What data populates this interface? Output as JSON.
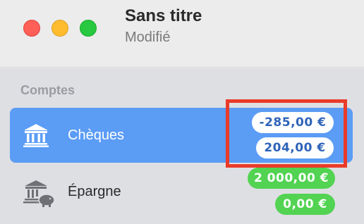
{
  "window": {
    "title": "Sans titre",
    "subtitle": "Modifié"
  },
  "sidebar": {
    "section_header": "Comptes",
    "accounts": [
      {
        "label": "Chèques",
        "icon": "bank-icon",
        "selected": true,
        "balances": [
          "-285,00 €",
          "204,00 €"
        ]
      },
      {
        "label": "Épargne",
        "icon": "savings-bank-icon",
        "selected": false,
        "balances": [
          "2 000,00 €",
          "0,00 €"
        ]
      }
    ]
  },
  "colors": {
    "selection": "#5b9cf5",
    "pill_blue_text": "#2f64b8",
    "pill_green": "#52d352",
    "highlight": "#ea3b2a"
  }
}
